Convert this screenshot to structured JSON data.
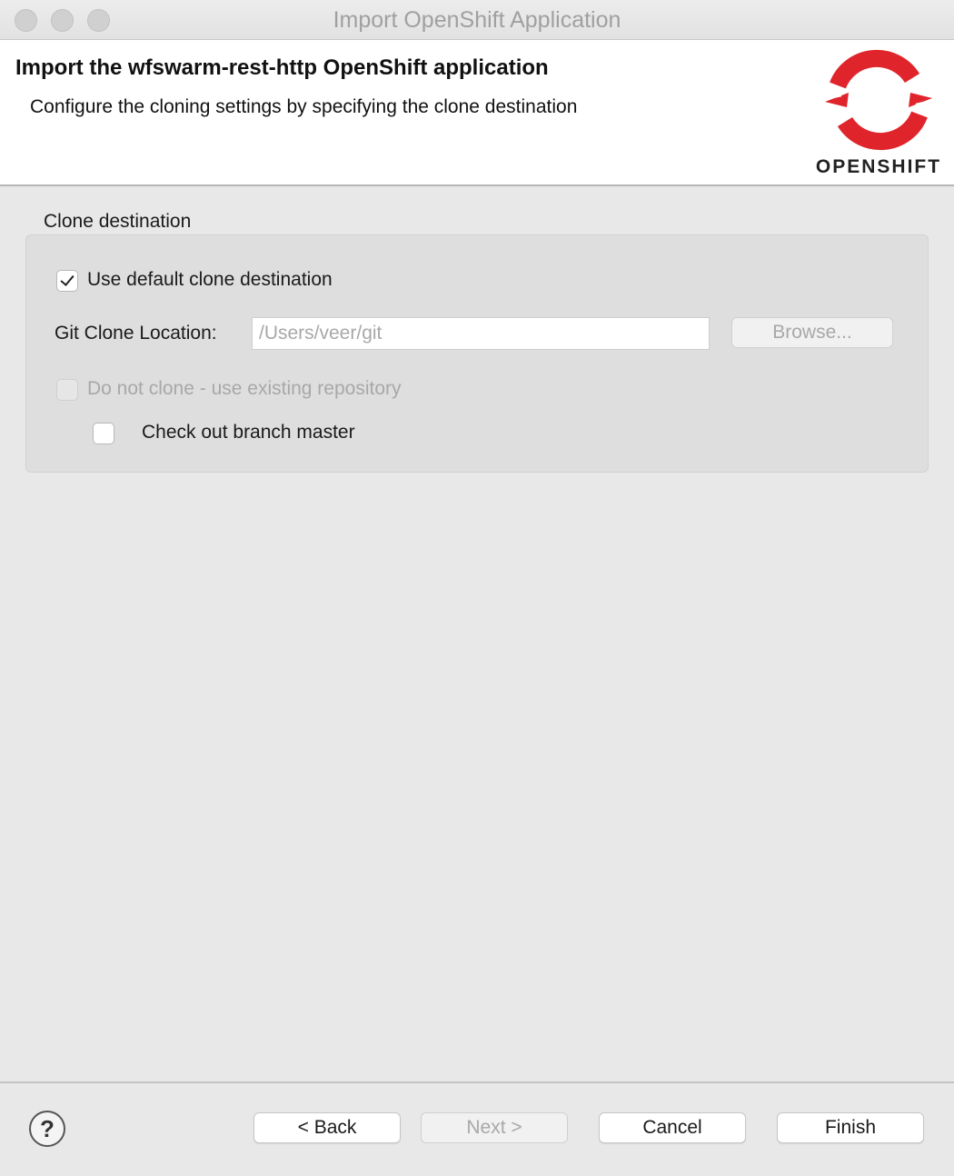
{
  "window": {
    "title": "Import OpenShift Application"
  },
  "banner": {
    "title": "Import the wfswarm-rest-http OpenShift application",
    "description": "Configure the cloning settings by specifying the clone destination",
    "logo_text": "OPENSHIFT",
    "logo_color": "#e0242b"
  },
  "clone": {
    "group_label": "Clone destination",
    "use_default_label": "Use default clone destination",
    "use_default_checked": true,
    "location_label": "Git Clone Location:",
    "location_value": "/Users/veer/git",
    "browse_label": "Browse...",
    "do_not_clone_label": "Do not clone - use existing repository",
    "do_not_clone_checked": false,
    "checkout_label": "Check out branch master",
    "checkout_checked": false
  },
  "footer": {
    "help_symbol": "?",
    "back_label": "< Back",
    "next_label": "Next >",
    "cancel_label": "Cancel",
    "finish_label": "Finish"
  }
}
